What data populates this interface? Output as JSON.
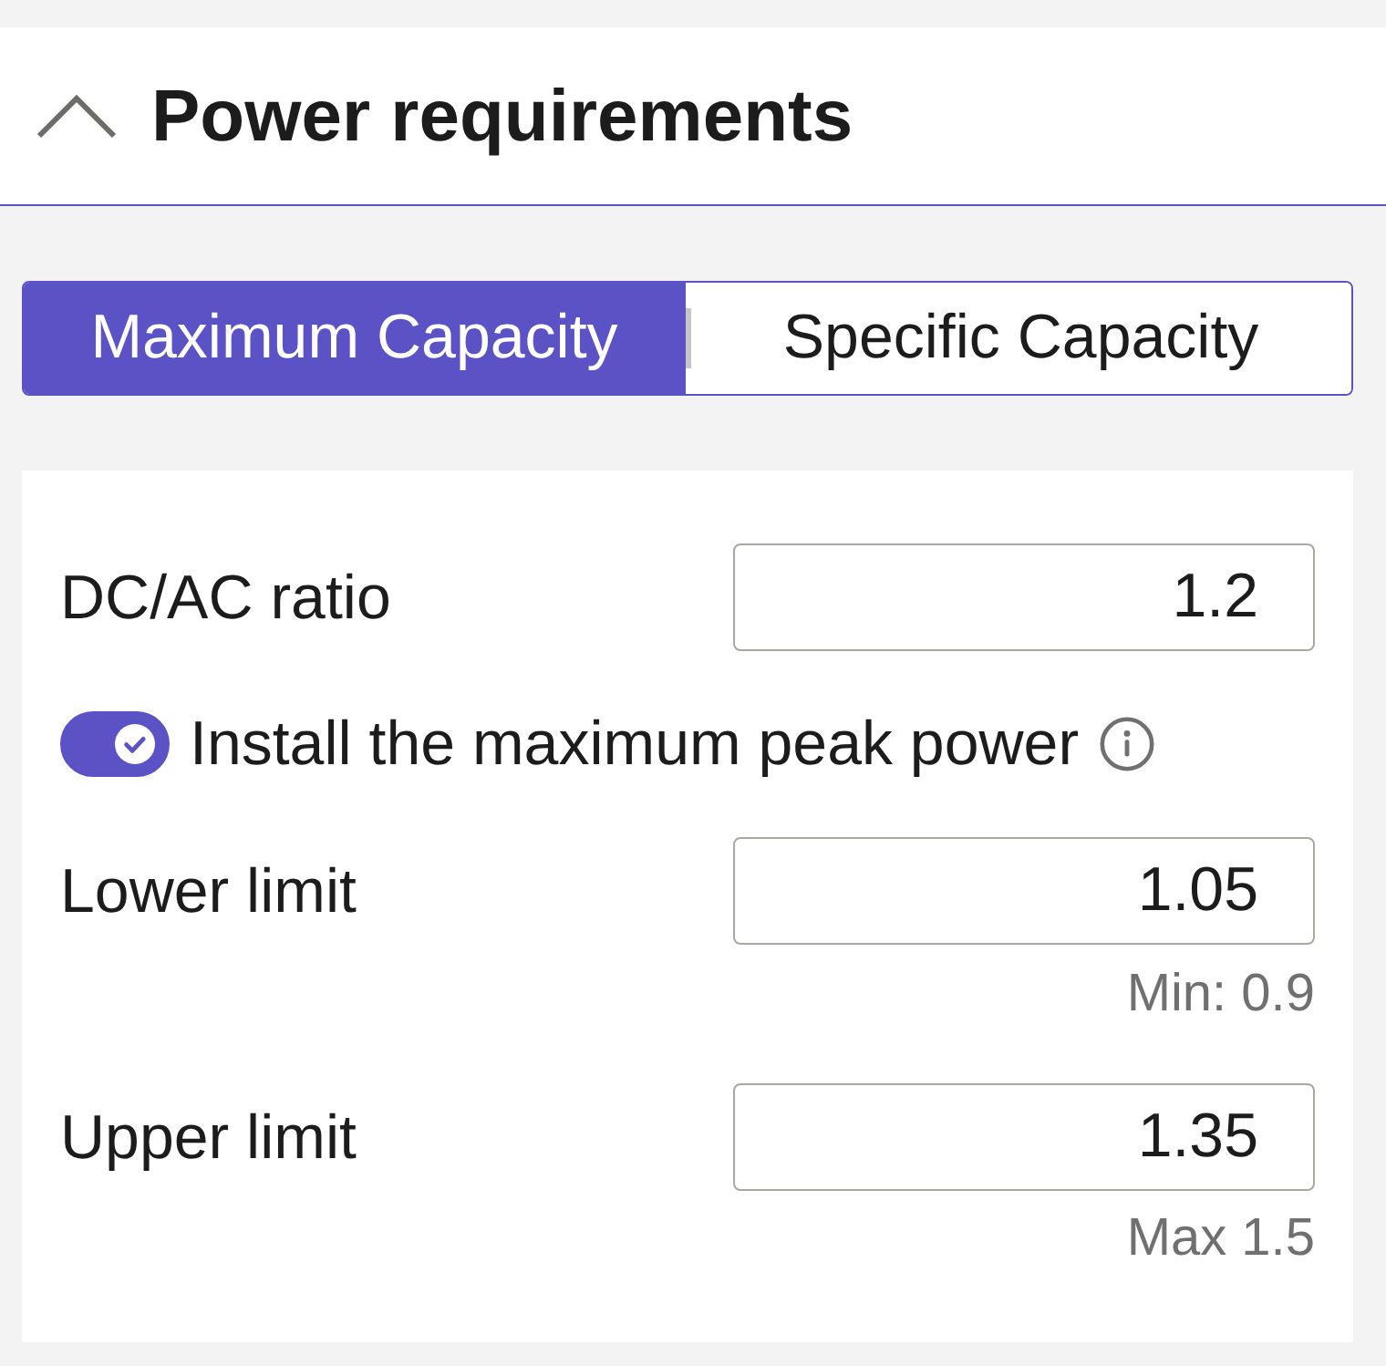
{
  "section": {
    "title": "Power requirements",
    "expanded": true
  },
  "tabs": [
    {
      "label": "Maximum Capacity",
      "selected": true
    },
    {
      "label": "Specific Capacity",
      "selected": false
    }
  ],
  "fields": [
    {
      "kind": "input",
      "label": "DC/AC ratio",
      "value": "1.2"
    },
    {
      "kind": "toggle",
      "label": "Install the maximum peak power",
      "on": true
    },
    {
      "kind": "input",
      "label": "Lower limit",
      "value": "1.05",
      "hint": "Min: 0.9"
    },
    {
      "kind": "input",
      "label": "Upper limit",
      "value": "1.35",
      "hint": "Max 1.5"
    }
  ]
}
